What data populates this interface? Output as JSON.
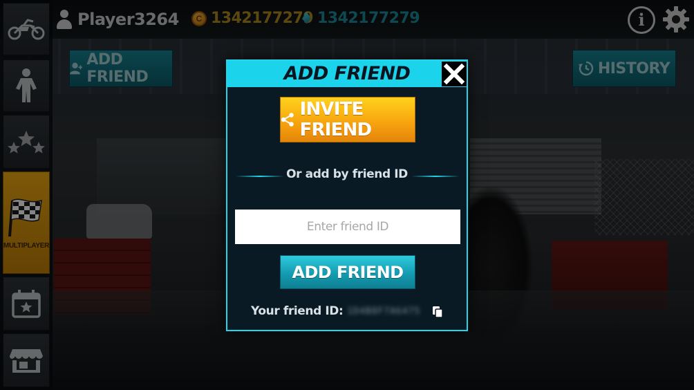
{
  "player": {
    "name": "Player3264"
  },
  "currency": {
    "coins": "1342177279",
    "gems": "1342177279",
    "coin_glyph": "C"
  },
  "sidebar": {
    "items": [
      {
        "icon": "motorbike-icon",
        "label": ""
      },
      {
        "icon": "rider-icon",
        "label": ""
      },
      {
        "icon": "stars-icon",
        "label": ""
      },
      {
        "icon": "checkered-flag-icon",
        "label": "MULTIPLAYER",
        "active": true
      },
      {
        "icon": "calendar-star-icon",
        "label": ""
      },
      {
        "icon": "shop-icon",
        "label": ""
      }
    ]
  },
  "background_buttons": {
    "add_friend": "ADD FRIEND",
    "history": "HISTORY"
  },
  "modal": {
    "title": "ADD FRIEND",
    "invite_label": "INVITE FRIEND",
    "or_text": "Or add by friend ID",
    "input_placeholder": "Enter friend ID",
    "input_value": "",
    "add_label": "ADD FRIEND",
    "friend_id_label": "Your friend ID:",
    "friend_id_value": "1D4B8F7A6475"
  },
  "colors": {
    "accent_cyan": "#1bd3eb",
    "invite_orange": "#f6a10e",
    "active_tab_gold": "#e3a112",
    "coin_text": "#a9851c",
    "gem_text": "#1b8695"
  },
  "icons": {
    "info": "info-icon",
    "settings": "gear-icon",
    "close": "close-icon",
    "share": "share-icon",
    "copy": "copy-icon",
    "history": "history-icon",
    "add_user": "add-user-icon"
  }
}
